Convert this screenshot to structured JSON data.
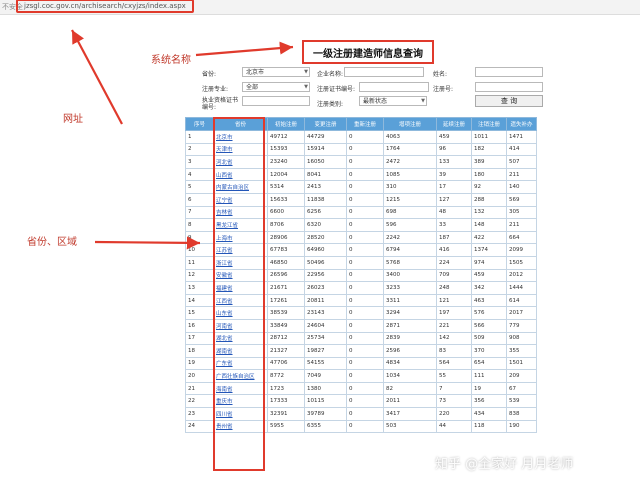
{
  "browser": {
    "address_prefix": "不安全",
    "url": "jzsgl.coc.gov.cn/archisearch/cxyjzs/index.aspx"
  },
  "page": {
    "title": "一级注册建造师信息查询"
  },
  "annotations": {
    "system_name": "系统名称",
    "url": "网址",
    "province_region": "省份、区域",
    "color": "#e03a2c"
  },
  "search_form": {
    "province_label": "省份:",
    "province_value": "北京市",
    "company_label": "企业名称:",
    "company_value": "",
    "name_label": "姓名:",
    "name_value": "",
    "major_label": "注册专业:",
    "major_value": "全部",
    "cert_label": "注册证书编号:",
    "cert_value": "",
    "reg_no_label": "注册号:",
    "reg_no_value": "",
    "license_label_line1": "执业资格证书",
    "license_label_line2": "编号:",
    "license_value": "",
    "reg_type_label": "注册类别:",
    "reg_type_value": "最新状态",
    "search_button": "查 询"
  },
  "table": {
    "header_color": "#5aa0d8",
    "headers": [
      "序号",
      "省份",
      "初始注册",
      "变更注册",
      "重新注册",
      "增项注册",
      "延续注册",
      "注销注册",
      "遗失补办"
    ],
    "rows": [
      [
        "1",
        "北京市",
        "49712",
        "44729",
        "0",
        "4063",
        "459",
        "1011",
        "1471"
      ],
      [
        "2",
        "天津市",
        "15393",
        "15914",
        "0",
        "1764",
        "96",
        "182",
        "414"
      ],
      [
        "3",
        "河北省",
        "23240",
        "16050",
        "0",
        "2472",
        "133",
        "389",
        "507"
      ],
      [
        "4",
        "山西省",
        "12004",
        "8041",
        "0",
        "1085",
        "39",
        "180",
        "211"
      ],
      [
        "5",
        "内蒙古自治区",
        "5314",
        "2413",
        "0",
        "310",
        "17",
        "92",
        "140"
      ],
      [
        "6",
        "辽宁省",
        "15633",
        "11838",
        "0",
        "1215",
        "127",
        "288",
        "569"
      ],
      [
        "7",
        "吉林省",
        "6600",
        "6256",
        "0",
        "698",
        "48",
        "132",
        "305"
      ],
      [
        "8",
        "黑龙江省",
        "8706",
        "6320",
        "0",
        "596",
        "33",
        "148",
        "211"
      ],
      [
        "9",
        "上海市",
        "28906",
        "28520",
        "0",
        "2242",
        "187",
        "422",
        "664"
      ],
      [
        "10",
        "江苏省",
        "67783",
        "64960",
        "0",
        "6794",
        "416",
        "1374",
        "2099"
      ],
      [
        "11",
        "浙江省",
        "46850",
        "50496",
        "0",
        "5768",
        "224",
        "974",
        "1505"
      ],
      [
        "12",
        "安徽省",
        "26596",
        "22956",
        "0",
        "3400",
        "709",
        "459",
        "2012"
      ],
      [
        "13",
        "福建省",
        "21671",
        "26023",
        "0",
        "3233",
        "248",
        "342",
        "1444"
      ],
      [
        "14",
        "江西省",
        "17261",
        "20811",
        "0",
        "3311",
        "121",
        "463",
        "614"
      ],
      [
        "15",
        "山东省",
        "38539",
        "23143",
        "0",
        "3294",
        "197",
        "576",
        "2017"
      ],
      [
        "16",
        "河南省",
        "33849",
        "24604",
        "0",
        "2871",
        "221",
        "566",
        "779"
      ],
      [
        "17",
        "湖北省",
        "28712",
        "25734",
        "0",
        "2839",
        "142",
        "509",
        "908"
      ],
      [
        "18",
        "湖南省",
        "21327",
        "19827",
        "0",
        "2596",
        "83",
        "370",
        "355"
      ],
      [
        "19",
        "广东省",
        "47706",
        "54155",
        "0",
        "4834",
        "564",
        "654",
        "1501"
      ],
      [
        "20",
        "广西壮族自治区",
        "8772",
        "7049",
        "0",
        "1034",
        "55",
        "111",
        "209"
      ],
      [
        "21",
        "海南省",
        "1723",
        "1380",
        "0",
        "82",
        "7",
        "19",
        "67"
      ],
      [
        "22",
        "重庆市",
        "17333",
        "10115",
        "0",
        "2011",
        "73",
        "356",
        "539"
      ],
      [
        "23",
        "四川省",
        "32391",
        "39789",
        "0",
        "3417",
        "220",
        "434",
        "838"
      ],
      [
        "24",
        "贵州省",
        "5955",
        "6355",
        "0",
        "503",
        "44",
        "118",
        "190"
      ]
    ]
  },
  "watermark": "知乎 @全家好 月月老师"
}
